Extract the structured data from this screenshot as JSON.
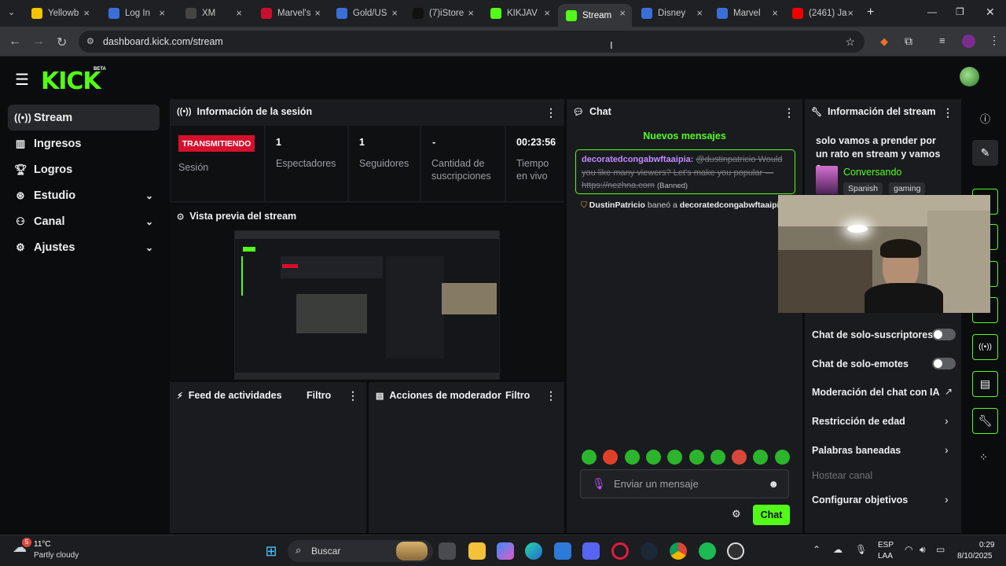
{
  "browser": {
    "tabs": [
      {
        "label": "Yellowb",
        "icon": "yellow-y-icon",
        "color": "#f5c400"
      },
      {
        "label": "Log In",
        "icon": "globe-icon",
        "color": "#3a6fd8"
      },
      {
        "label": "XM",
        "icon": "xm-icon",
        "color": "#444"
      },
      {
        "label": "Marvel's",
        "icon": "marvel-icon",
        "color": "#c8102e"
      },
      {
        "label": "Gold/US",
        "icon": "globe-icon",
        "color": "#3a6fd8"
      },
      {
        "label": "(7)iStore",
        "icon": "tiktok-icon",
        "color": "#111"
      },
      {
        "label": "KIKJAV",
        "icon": "kick-icon",
        "color": "#53fc18"
      },
      {
        "label": "Stream",
        "icon": "kick-icon",
        "color": "#53fc18"
      },
      {
        "label": "Disney",
        "icon": "globe-icon",
        "color": "#3a6fd8"
      },
      {
        "label": "Marvel",
        "icon": "globe-icon",
        "color": "#3a6fd8"
      },
      {
        "label": "(2461) Ja",
        "icon": "youtube-icon",
        "color": "#e00"
      }
    ],
    "url": "dashboard.kick.com/stream"
  },
  "brand": {
    "logo": "KICK",
    "beta": "BETA",
    "accent": "#53fc18"
  },
  "sidebar": {
    "items": [
      {
        "label": "Stream",
        "icon": "stream-icon"
      },
      {
        "label": "Ingresos",
        "icon": "chart-icon"
      },
      {
        "label": "Logros",
        "icon": "trophy-icon"
      },
      {
        "label": "Estudio",
        "icon": "studio-icon"
      },
      {
        "label": "Canal",
        "icon": "channel-icon"
      },
      {
        "label": "Ajustes",
        "icon": "gear-icon"
      }
    ]
  },
  "session": {
    "title": "Información de la sesión",
    "badge": "TRANSMITIENDO",
    "session_label": "Sesión",
    "viewers_value": "1",
    "viewers_label": "Espectadores",
    "followers_value": "1",
    "followers_label": "Seguidores",
    "subs_value": "-",
    "subs_label": "Cantidad de suscripciones",
    "time_value": "00:23:56",
    "time_label": "Tiempo en vivo"
  },
  "preview": {
    "title": "Vista previa del stream"
  },
  "feed": {
    "title": "Feed de actividades",
    "filter": "Filtro"
  },
  "mod": {
    "title": "Acciones de moderador",
    "filter": "Filtro"
  },
  "chat": {
    "title": "Chat",
    "new_messages": "Nuevos mensajes",
    "message_user": "decoratedcongabwftaaipia:",
    "message_text": "@dustinpatricio Would you like many viewers? Let's make you popular — https://nezhna.com",
    "message_status": "(Banned)",
    "ban_actor": "DustinPatricio",
    "ban_verb": "baneó a",
    "ban_target": "decoratedcongabwftaaipia",
    "input_placeholder": "Enviar un mensaje",
    "send": "Chat"
  },
  "stream_info": {
    "title": "Información del stream",
    "stream_title": "solo vamos a prender por un rato en stream y vamos a...",
    "category": "Conversando",
    "tags": [
      "Spanish",
      "gaming"
    ],
    "sub_only": "Chat de solo-suscriptores",
    "emote_only": "Chat de solo-emotes",
    "ai_mod": "Moderación del chat con IA",
    "age": "Restricción de edad",
    "banned_words": "Palabras baneadas",
    "host": "Hostear canal",
    "goals": "Configurar objetivos"
  },
  "taskbar": {
    "weather_temp": "11°C",
    "weather_desc": "Partly cloudy",
    "weather_badge": "5",
    "search": "Buscar",
    "lang1": "ESP",
    "lang2": "LAA",
    "time": "0:29",
    "date": "8/10/2025"
  }
}
